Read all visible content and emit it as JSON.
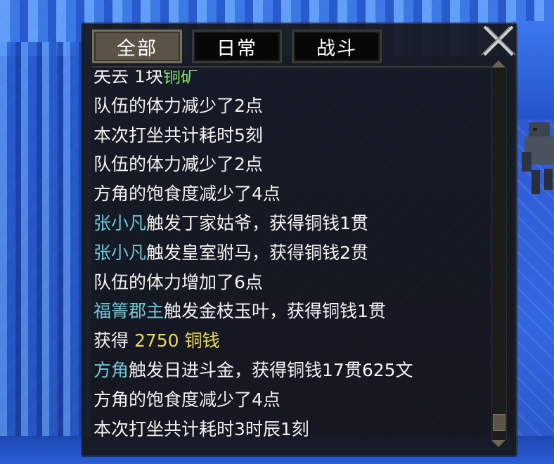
{
  "tabs": [
    {
      "label": "全部",
      "active": true
    },
    {
      "label": "日常",
      "active": false
    },
    {
      "label": "战斗",
      "active": false
    }
  ],
  "log": [
    [
      {
        "t": "失去 1块",
        "c": "white"
      },
      {
        "t": "铜矿",
        "c": "green"
      }
    ],
    [
      {
        "t": "队伍的体力减少了2点",
        "c": "white"
      }
    ],
    [
      {
        "t": "本次打坐共计耗时5刻",
        "c": "white"
      }
    ],
    [
      {
        "t": "队伍的体力减少了2点",
        "c": "white"
      }
    ],
    [
      {
        "t": "方角的饱食度减少了4点",
        "c": "white"
      }
    ],
    [
      {
        "t": "张小凡",
        "c": "name"
      },
      {
        "t": "触发丁家姑爷，获得铜钱1贯",
        "c": "white"
      }
    ],
    [
      {
        "t": "张小凡",
        "c": "name"
      },
      {
        "t": "触发皇室驸马，获得铜钱2贯",
        "c": "white"
      }
    ],
    [
      {
        "t": "队伍的体力增加了6点",
        "c": "white"
      }
    ],
    [
      {
        "t": "福箐郡主",
        "c": "name"
      },
      {
        "t": "触发金枝玉叶，获得铜钱1贯",
        "c": "white"
      }
    ],
    [
      {
        "t": "获得 ",
        "c": "white"
      },
      {
        "t": "2750 铜钱",
        "c": "gold"
      }
    ],
    [
      {
        "t": "方角",
        "c": "name"
      },
      {
        "t": "触发日进斗金，获得铜钱17贯625文",
        "c": "white"
      }
    ],
    [
      {
        "t": "方角的饱食度减少了4点",
        "c": "white"
      }
    ],
    [
      {
        "t": "本次打坐共计耗时3时辰1刻",
        "c": "white"
      }
    ]
  ],
  "scroll_position": 0.97,
  "icons": {
    "close": "close-x-icon",
    "scroll_up": "arrow-up-icon",
    "scroll_down": "arrow-down-icon"
  },
  "colors": {
    "text": "#f3f3f3",
    "name": "#6fc7d8",
    "gold": "#ecd95a",
    "green": "#7fe06a",
    "active_tab": "#5a5446"
  }
}
